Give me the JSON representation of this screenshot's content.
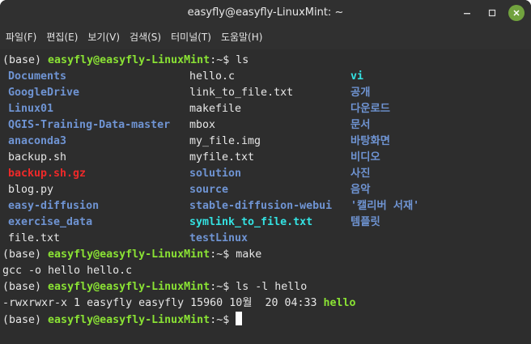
{
  "window": {
    "title": "easyfly@easyfly-LinuxMint: ~",
    "icons": {
      "minimize": "minimize-icon",
      "maximize": "maximize-icon",
      "close": "close-icon"
    },
    "accent_close": "#71a23e"
  },
  "menu": [
    "파일(F)",
    "편집(E)",
    "보기(V)",
    "검색(S)",
    "터미널(T)",
    "도움말(H)"
  ],
  "colors": {
    "background": "#2d2d2d",
    "prompt_user": "#8ae234",
    "directory": "#6f94d3",
    "executable": "#8ae234",
    "symlink": "#34e2e2",
    "archive": "#ef2929",
    "text": "#e6e6e6"
  },
  "terminal": {
    "prompt_env": "(base) ",
    "prompt_user": "easyfly@easyfly-LinuxMint",
    "prompt_path": ":~$ ",
    "cmd_ls": "ls",
    "ls_rows": [
      [
        {
          "t": "Documents",
          "k": "dir"
        },
        {
          "t": "hello.c",
          "k": "file"
        },
        {
          "t": "vi",
          "k": "link"
        }
      ],
      [
        {
          "t": "GoogleDrive",
          "k": "dir"
        },
        {
          "t": "link_to_file.txt",
          "k": "file"
        },
        {
          "t": "공개",
          "k": "dir"
        }
      ],
      [
        {
          "t": "Linux01",
          "k": "dir"
        },
        {
          "t": "makefile",
          "k": "file"
        },
        {
          "t": "다운로드",
          "k": "dir"
        }
      ],
      [
        {
          "t": "QGIS-Training-Data-master",
          "k": "dir"
        },
        {
          "t": "mbox",
          "k": "file"
        },
        {
          "t": "문서",
          "k": "dir"
        }
      ],
      [
        {
          "t": "anaconda3",
          "k": "dir"
        },
        {
          "t": "my_file.img",
          "k": "file"
        },
        {
          "t": "바탕화면",
          "k": "dir"
        }
      ],
      [
        {
          "t": "backup.sh",
          "k": "file"
        },
        {
          "t": "myfile.txt",
          "k": "file"
        },
        {
          "t": "비디오",
          "k": "dir"
        }
      ],
      [
        {
          "t": "backup.sh.gz",
          "k": "arch"
        },
        {
          "t": "solution",
          "k": "dir"
        },
        {
          "t": "사진",
          "k": "dir"
        }
      ],
      [
        {
          "t": "blog.py",
          "k": "file"
        },
        {
          "t": "source",
          "k": "dir"
        },
        {
          "t": "음악",
          "k": "dir"
        }
      ],
      [
        {
          "t": "easy-diffusion",
          "k": "dir"
        },
        {
          "t": "stable-diffusion-webui",
          "k": "dir"
        },
        {
          "t": "'캘리버 서재'",
          "k": "dir"
        }
      ],
      [
        {
          "t": "exercise_data",
          "k": "dir"
        },
        {
          "t": "symlink_to_file.txt",
          "k": "link"
        },
        {
          "t": "템플릿",
          "k": "dir"
        }
      ],
      [
        {
          "t": "file.txt",
          "k": "file"
        },
        {
          "t": "testLinux",
          "k": "dir"
        },
        {
          "t": "",
          "k": "file"
        }
      ]
    ],
    "cmd_make": "make",
    "make_output": "gcc -o hello hello.c",
    "cmd_ls_l": "ls -l hello",
    "ls_l_output": "-rwxrwxr-x 1 easyfly easyfly 15960 10월  20 04:33 ",
    "ls_l_name": "hello"
  }
}
